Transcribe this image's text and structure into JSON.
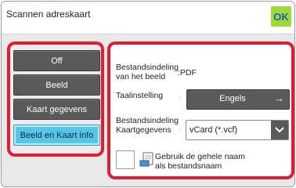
{
  "header": {
    "title": "Scannen adreskaart",
    "ok_label": "OK"
  },
  "modes": [
    {
      "label": "Off",
      "selected": false
    },
    {
      "label": "Beeld",
      "selected": false
    },
    {
      "label": "Kaart gegevens",
      "selected": false
    },
    {
      "label": "Beeld en Kaart info",
      "selected": true
    }
  ],
  "settings": {
    "file_format_label_line1": "Bestandsindeling",
    "file_format_label_line2": "van het beeld",
    "file_format_value": ":PDF",
    "language_label": "Taalinstelling",
    "language_value": "Engels",
    "card_format_label_line1": "Bestandsindeling",
    "card_format_label_line2": "Kaartgegevens",
    "card_format_value": "vCard (*.vcf)",
    "use_full_name_line1": "Gebruik de gehele naam",
    "use_full_name_line2": "als bestandsnaam",
    "use_full_name_checked": false
  },
  "colors": {
    "highlight_border": "#e21d33",
    "selected_button": "#55c6e4",
    "ok_button": "#9fd83a"
  }
}
